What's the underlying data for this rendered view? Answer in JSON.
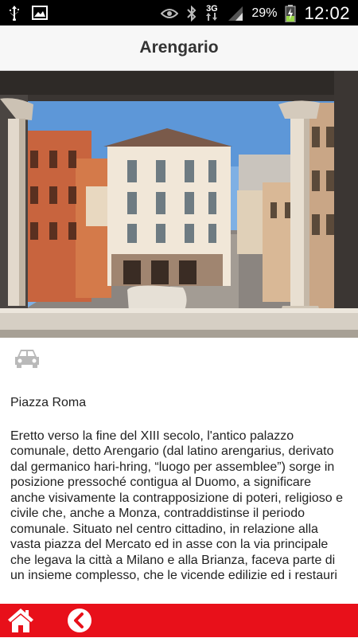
{
  "status_bar": {
    "battery_percent": "29%",
    "time": "12:02",
    "network": "3G",
    "icons": [
      "usb-icon",
      "image-icon",
      "eye-icon",
      "bluetooth-icon",
      "network-arrows-icon",
      "signal-icon",
      "battery-charging-icon"
    ]
  },
  "header": {
    "title": "Arengario"
  },
  "hero": {
    "image": "arengario-photo"
  },
  "info": {
    "transport_icon": "car-icon",
    "place": "Piazza Roma",
    "description": "Eretto verso la fine del XIII secolo, l'antico palazzo comunale, detto Arengario (dal latino arengarius, derivato dal germanico hari-hring, “luogo per assemblee”) sorge in posizione pressoché contigua al Duomo, a significare anche visivamente la contrapposizione di poteri, religioso e civile che, anche a Monza, contraddistinse il periodo comunale. Situato nel centro cittadino, in relazione alla vasta piazza del Mercato ed in asse con la via principale che legava la città a Milano e alla Brianza, faceva parte di un insieme complesso, che le vicende edilizie ed i restauri"
  },
  "bottom_bar": {
    "color": "#e8101a",
    "home_icon": "home-icon",
    "back_icon": "back-icon"
  }
}
